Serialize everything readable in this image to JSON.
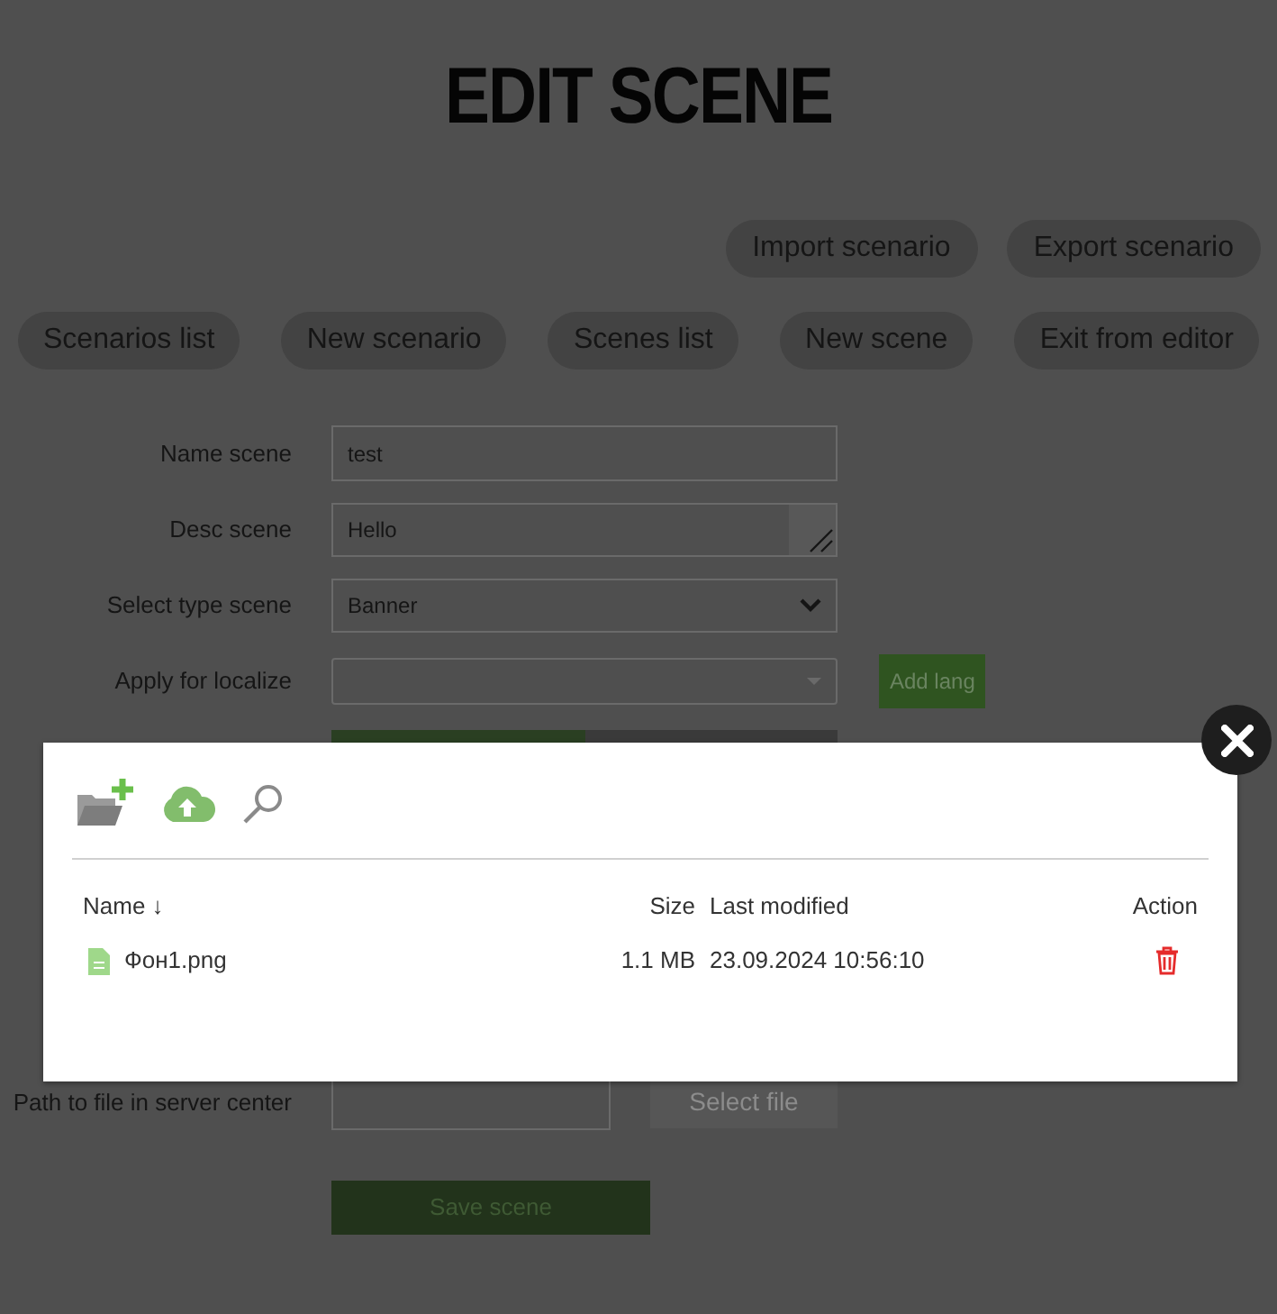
{
  "title": "EDIT SCENE",
  "top_actions": [
    "Import scenario",
    "Export scenario"
  ],
  "nav_actions": [
    "Scenarios list",
    "New scenario",
    "Scenes list",
    "New scene",
    "Exit from editor"
  ],
  "form": {
    "name": {
      "label": "Name scene",
      "value": "test"
    },
    "desc": {
      "label": "Desc scene",
      "value": "Hello"
    },
    "type": {
      "label": "Select type scene",
      "value": "Banner"
    },
    "localize": {
      "label": "Apply for localize",
      "button": "Add lang"
    },
    "path": {
      "label": "Path to file in server center",
      "button": "Select file"
    },
    "save": "Save scene"
  },
  "file_dialog": {
    "columns": [
      "Name ↓",
      "Size",
      "Last modified",
      "Action"
    ],
    "files": [
      {
        "name": "Фон1.png",
        "size": "1.1 MB",
        "modified": "23.09.2024 10:56:10"
      }
    ]
  }
}
